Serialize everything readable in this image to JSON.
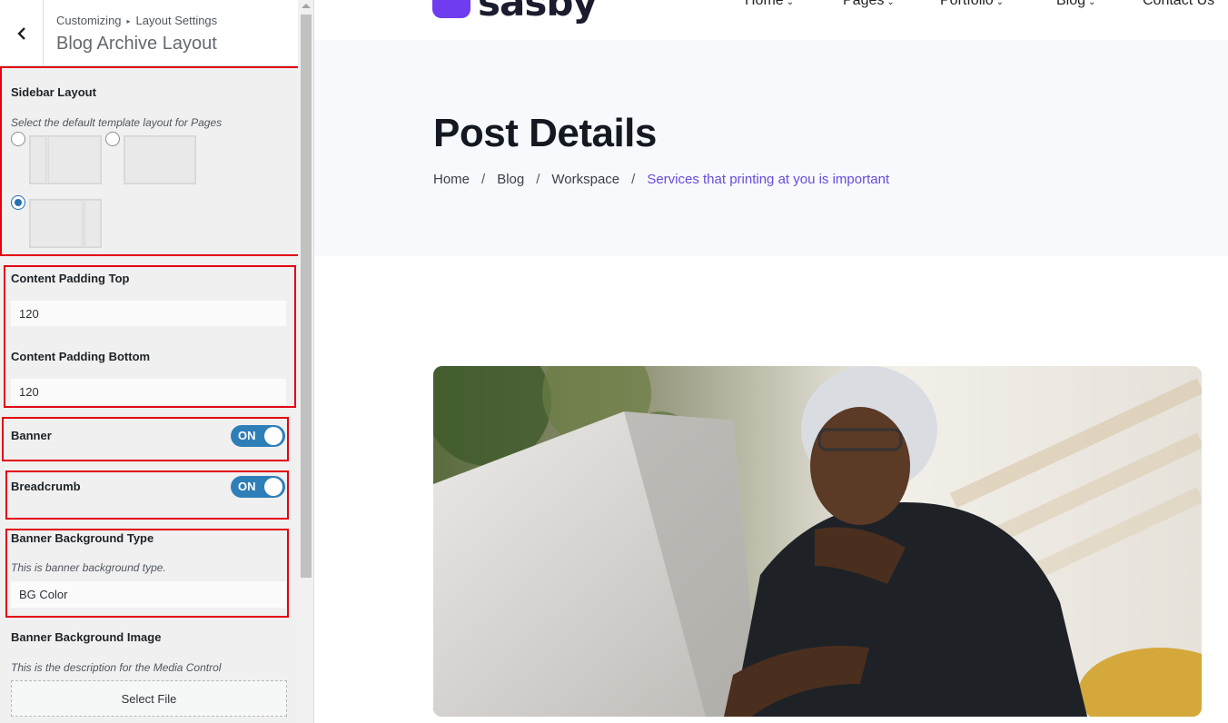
{
  "customizer": {
    "breadcrumb_root": "Customizing",
    "breadcrumb_parent": "Layout Settings",
    "section_title": "Blog Archive Layout",
    "sidebar_layout": {
      "title": "Sidebar Layout",
      "description": "Select the default template layout for Pages",
      "options": [
        "left-sidebar",
        "no-sidebar",
        "right-sidebar"
      ],
      "selected": "right-sidebar"
    },
    "content_padding_top": {
      "title": "Content Padding Top",
      "value": "120"
    },
    "content_padding_bottom": {
      "title": "Content Padding Bottom",
      "value": "120"
    },
    "banner": {
      "title": "Banner",
      "state": "ON"
    },
    "breadcrumb": {
      "title": "Breadcrumb",
      "state": "ON"
    },
    "banner_bg_type": {
      "title": "Banner Background Type",
      "description": "This is banner background type.",
      "value": "BG Color"
    },
    "banner_bg_image": {
      "title": "Banner Background Image",
      "description": "This is the description for the Media Control",
      "button": "Select File"
    }
  },
  "site": {
    "logo_text": "sasby",
    "nav": [
      "Home",
      "Pages",
      "Portfolio",
      "Blog",
      "Contact Us"
    ],
    "page_title": "Post Details",
    "breadcrumb": [
      "Home",
      "Blog",
      "Workspace"
    ],
    "breadcrumb_current": "Services that printing at you is important"
  },
  "colors": {
    "highlight_border": "#e3000f",
    "toggle_on": "#2e7fb8",
    "accent": "#6a4bdb",
    "banner_bg": "#f7f9fc"
  }
}
